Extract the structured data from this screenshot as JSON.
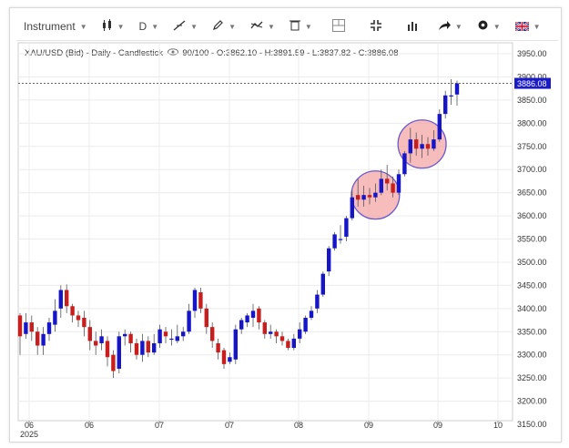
{
  "toolbar": {
    "instrument_label": "Instrument",
    "timeframe_label": "D",
    "icons": [
      "candlestick-icon",
      "timeframe-icon",
      "trendline-icon",
      "pencil-icon",
      "tools-icon",
      "trash-icon",
      "crosshair-icon",
      "fullscreen-icon",
      "indicators-icon",
      "share-icon",
      "settings-icon",
      "flag-icon"
    ]
  },
  "info": {
    "symbol_line": "XAU/USD (Bid) - Daily - Candlestick",
    "sentiment": "90/100",
    "ohlc": "- O:3862.10 - H:3891.59 - L:3837.82 - C:3886.08"
  },
  "chart_data": {
    "type": "candlestick",
    "title": "XAU/USD (Bid) - Daily - Candlestick",
    "ylim": [
      3150,
      3960
    ],
    "y_ticks": [
      "3950.00",
      "3900.00",
      "3850.00",
      "3800.00",
      "3750.00",
      "3700.00",
      "3650.00",
      "3600.00",
      "3550.00",
      "3500.00",
      "3450.00",
      "3400.00",
      "3350.00",
      "3300.00",
      "3250.00",
      "3200.00",
      "3150.00"
    ],
    "x_ticks": [
      "06",
      "06",
      "07",
      "07",
      "08",
      "09",
      "09",
      "10"
    ],
    "x_year": "2025",
    "last_price": "3886.08",
    "up_color": "#1616c8",
    "down_color": "#c81e1e",
    "highlight_color": "#f4a0a0",
    "candles": [
      [
        3385,
        3340,
        3390,
        3300
      ],
      [
        3345,
        3370,
        3390,
        3335
      ],
      [
        3370,
        3350,
        3385,
        3330
      ],
      [
        3350,
        3320,
        3360,
        3300
      ],
      [
        3320,
        3345,
        3360,
        3300
      ],
      [
        3345,
        3370,
        3380,
        3330
      ],
      [
        3365,
        3395,
        3420,
        3350
      ],
      [
        3400,
        3440,
        3450,
        3380
      ],
      [
        3440,
        3405,
        3452,
        3390
      ],
      [
        3405,
        3385,
        3410,
        3370
      ],
      [
        3385,
        3375,
        3395,
        3360
      ],
      [
        3380,
        3360,
        3395,
        3340
      ],
      [
        3360,
        3330,
        3375,
        3310
      ],
      [
        3330,
        3320,
        3350,
        3300
      ],
      [
        3325,
        3340,
        3355,
        3310
      ],
      [
        3330,
        3295,
        3340,
        3275
      ],
      [
        3300,
        3265,
        3310,
        3250
      ],
      [
        3270,
        3340,
        3350,
        3260
      ],
      [
        3340,
        3345,
        3355,
        3320
      ],
      [
        3345,
        3325,
        3350,
        3305
      ],
      [
        3325,
        3300,
        3335,
        3290
      ],
      [
        3300,
        3330,
        3345,
        3285
      ],
      [
        3330,
        3305,
        3340,
        3295
      ],
      [
        3305,
        3325,
        3345,
        3300
      ],
      [
        3325,
        3355,
        3365,
        3315
      ],
      [
        3350,
        3340,
        3360,
        3325
      ],
      [
        3335,
        3335,
        3355,
        3320
      ],
      [
        3330,
        3340,
        3365,
        3325
      ],
      [
        3340,
        3350,
        3360,
        3330
      ],
      [
        3350,
        3395,
        3410,
        3345
      ],
      [
        3395,
        3440,
        3445,
        3380
      ],
      [
        3435,
        3400,
        3445,
        3390
      ],
      [
        3400,
        3360,
        3410,
        3345
      ],
      [
        3360,
        3330,
        3370,
        3315
      ],
      [
        3325,
        3305,
        3335,
        3290
      ],
      [
        3310,
        3280,
        3315,
        3270
      ],
      [
        3285,
        3295,
        3305,
        3280
      ],
      [
        3290,
        3355,
        3365,
        3280
      ],
      [
        3355,
        3375,
        3380,
        3345
      ],
      [
        3370,
        3385,
        3390,
        3360
      ],
      [
        3380,
        3395,
        3410,
        3360
      ],
      [
        3400,
        3370,
        3405,
        3355
      ],
      [
        3370,
        3345,
        3375,
        3335
      ],
      [
        3345,
        3350,
        3365,
        3335
      ],
      [
        3350,
        3340,
        3355,
        3325
      ],
      [
        3340,
        3330,
        3350,
        3320
      ],
      [
        3330,
        3315,
        3335,
        3310
      ],
      [
        3315,
        3335,
        3345,
        3310
      ],
      [
        3335,
        3355,
        3370,
        3325
      ],
      [
        3350,
        3380,
        3385,
        3345
      ],
      [
        3380,
        3395,
        3405,
        3375
      ],
      [
        3400,
        3430,
        3440,
        3390
      ],
      [
        3430,
        3475,
        3480,
        3425
      ],
      [
        3480,
        3530,
        3535,
        3470
      ],
      [
        3530,
        3560,
        3565,
        3525
      ],
      [
        3550,
        3550,
        3580,
        3540
      ],
      [
        3555,
        3595,
        3600,
        3545
      ],
      [
        3595,
        3640,
        3655,
        3590
      ],
      [
        3645,
        3635,
        3680,
        3620
      ],
      [
        3635,
        3645,
        3665,
        3620
      ],
      [
        3645,
        3640,
        3660,
        3625
      ],
      [
        3640,
        3650,
        3670,
        3630
      ],
      [
        3650,
        3680,
        3700,
        3645
      ],
      [
        3680,
        3670,
        3710,
        3655
      ],
      [
        3670,
        3650,
        3685,
        3640
      ],
      [
        3650,
        3690,
        3700,
        3645
      ],
      [
        3690,
        3735,
        3740,
        3685
      ],
      [
        3735,
        3765,
        3790,
        3715
      ],
      [
        3765,
        3745,
        3780,
        3730
      ],
      [
        3745,
        3755,
        3775,
        3725
      ],
      [
        3755,
        3745,
        3770,
        3730
      ],
      [
        3745,
        3765,
        3785,
        3740
      ],
      [
        3765,
        3820,
        3830,
        3760
      ],
      [
        3820,
        3860,
        3870,
        3810
      ],
      [
        3860,
        3860,
        3895,
        3840
      ],
      [
        3862,
        3886,
        3892,
        3838
      ]
    ],
    "highlights": [
      {
        "center_index": 61,
        "center_price": 3645,
        "radius_price": 50
      },
      {
        "center_index": 69,
        "center_price": 3755,
        "radius_price": 50
      }
    ]
  }
}
